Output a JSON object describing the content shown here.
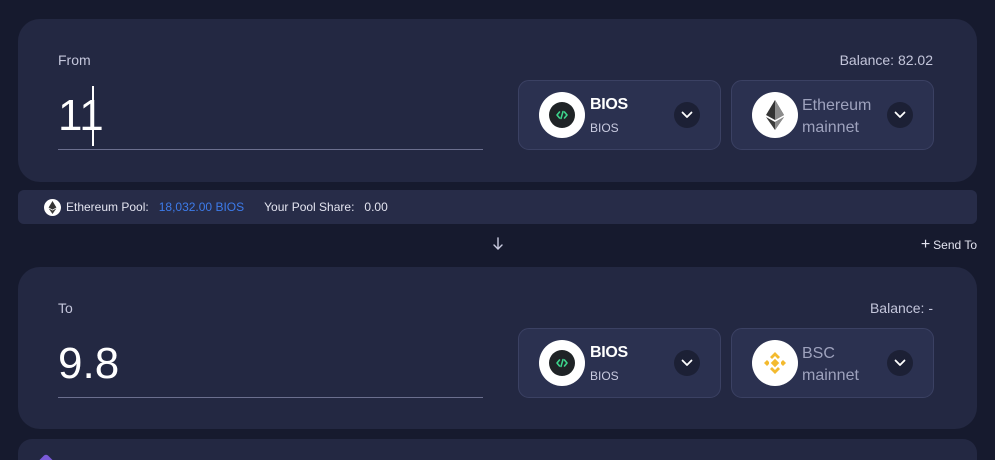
{
  "from": {
    "label": "From",
    "balance": "Balance: 82.02",
    "amount": "11",
    "token": {
      "name": "BIOS",
      "sub": "BIOS"
    },
    "network": {
      "name": "Ethereum mainnet"
    }
  },
  "pool": {
    "label": "Ethereum Pool:",
    "value": "18,032.00 BIOS",
    "share_label": "Your Pool Share:",
    "share_value": "0.00"
  },
  "send_to": {
    "label": "Send To"
  },
  "to": {
    "label": "To",
    "balance": "Balance: -",
    "amount": "9.8",
    "token": {
      "name": "BIOS",
      "sub": "BIOS"
    },
    "network": {
      "name": "BSC mainnet"
    }
  },
  "icons": {
    "bios": "bios-token-icon",
    "ethereum": "ethereum-icon",
    "bsc": "bnb-icon",
    "chevron": "chevron-down-icon",
    "arrow": "arrow-down-icon",
    "plus": "plus-icon"
  },
  "colors": {
    "background": "#161a2e",
    "card": "#232842",
    "accent_blue": "#3d7bea",
    "bnb_yellow": "#f3ba2f",
    "bios_green": "#3dd68c"
  }
}
